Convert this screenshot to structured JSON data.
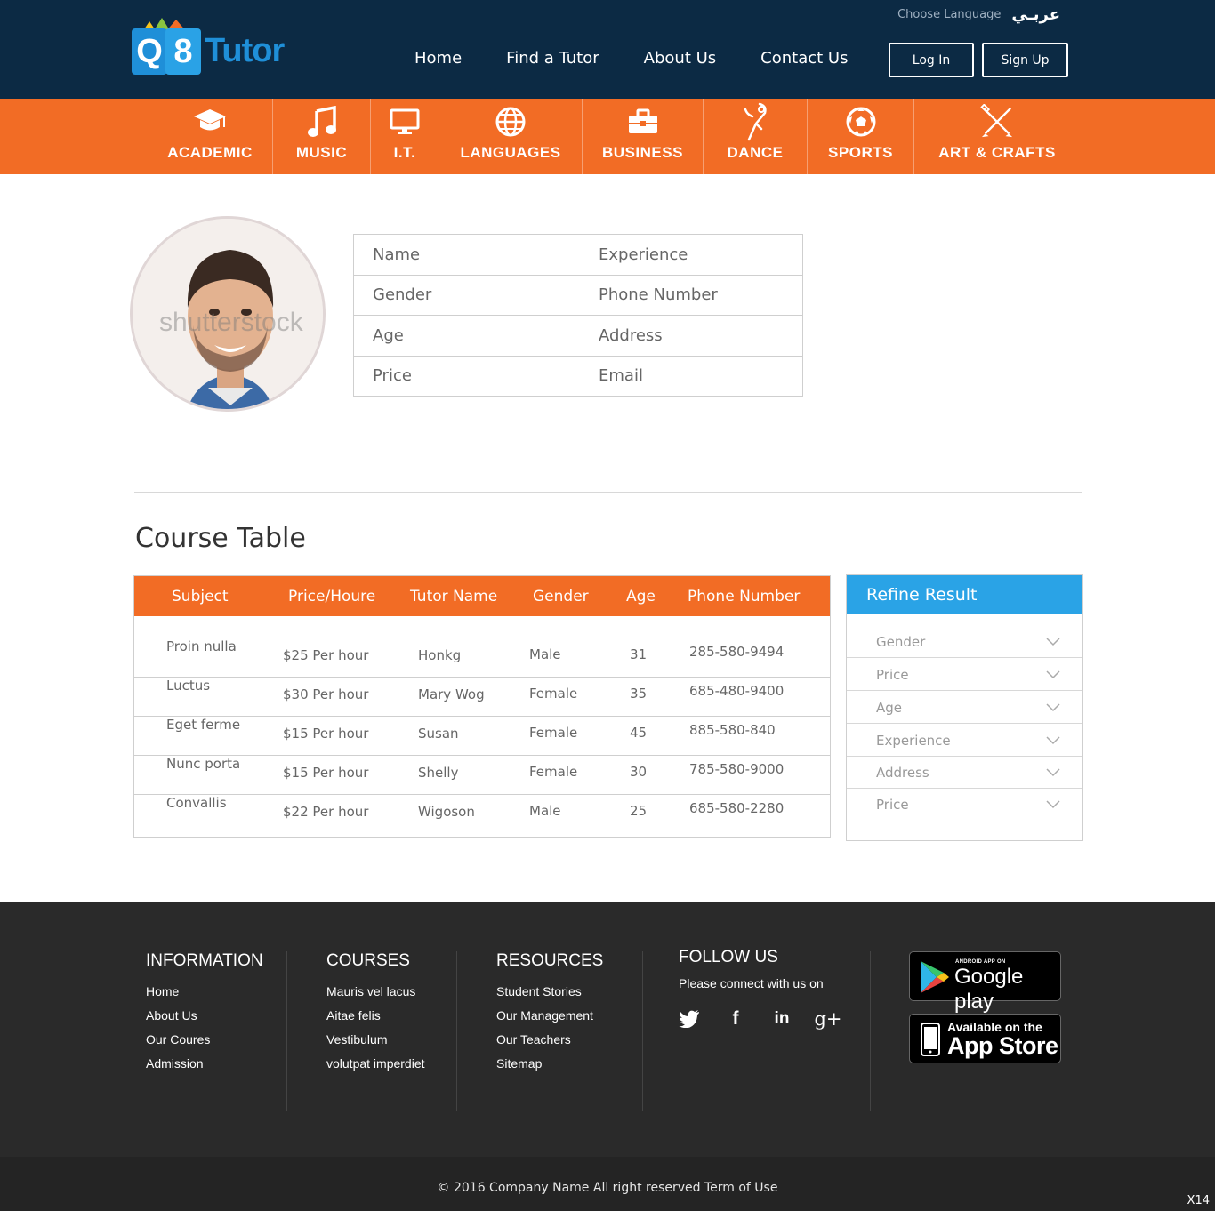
{
  "header": {
    "logo_text": "Tutor",
    "logo_q": "Q",
    "logo_8": "8",
    "choose_language": "Choose Language",
    "language_option": "عربـي",
    "nav": [
      "Home",
      "Find a Tutor",
      "About Us",
      "Contact Us"
    ],
    "login": "Log In",
    "signup": "Sign Up"
  },
  "categories": [
    {
      "label": "ACADEMIC",
      "icon": "graduation-cap-icon"
    },
    {
      "label": "MUSIC",
      "icon": "music-note-icon"
    },
    {
      "label": "I.T.",
      "icon": "monitor-icon"
    },
    {
      "label": "LANGUAGES",
      "icon": "globe-icon"
    },
    {
      "label": "BUSINESS",
      "icon": "briefcase-icon"
    },
    {
      "label": "DANCE",
      "icon": "dancer-icon"
    },
    {
      "label": "SPORTS",
      "icon": "soccer-ball-icon"
    },
    {
      "label": "ART & CRAFTS",
      "icon": "crossed-tools-icon"
    }
  ],
  "profile": {
    "watermark": "shutterstock",
    "fields": [
      [
        "Name",
        "Experience"
      ],
      [
        "Gender",
        "Phone Number"
      ],
      [
        "Age",
        "Address"
      ],
      [
        "Price",
        "Email"
      ]
    ]
  },
  "course_table": {
    "title": "Course Table",
    "headers": [
      "Subject",
      "Price/Houre",
      "Tutor Name",
      "Gender",
      "Age",
      "Phone Number"
    ],
    "rows": [
      [
        "Proin nulla",
        "$25 Per hour",
        "Honkg",
        "Male",
        "31",
        "285-580-9494"
      ],
      [
        "Luctus",
        "$30 Per hour",
        "Mary Wog",
        "Female",
        "35",
        "685-480-9400"
      ],
      [
        "Eget ferme",
        "$15 Per hour",
        "Susan",
        "Female",
        "45",
        "885-580-840"
      ],
      [
        "Nunc porta",
        "$15 Per hour",
        "Shelly",
        "Female",
        "30",
        "785-580-9000"
      ],
      [
        "Convallis",
        "$22 Per hour",
        "Wigoson",
        "Male",
        "25",
        "685-580-2280"
      ]
    ]
  },
  "refine": {
    "title": "Refine Result",
    "filters": [
      "Gender",
      "Price",
      "Age",
      "Experience",
      "Address",
      "Price"
    ]
  },
  "footer": {
    "information": {
      "title": "INFORMATION",
      "links": [
        "Home",
        "About Us",
        "Our Coures",
        "Admission"
      ]
    },
    "courses": {
      "title": "COURSES",
      "links": [
        "Mauris vel lacus",
        "Aitae felis",
        "Vestibulum",
        "volutpat imperdiet"
      ]
    },
    "resources": {
      "title": "RESOURCES",
      "links": [
        "Student Stories",
        "Our Management",
        "Our Teachers",
        "Sitemap"
      ]
    },
    "follow": {
      "title": "FOLLOW US",
      "text": "Please connect with us on",
      "icons": [
        "twitter-icon",
        "facebook-icon",
        "linkedin-icon",
        "google-plus-icon"
      ]
    },
    "google_play": {
      "small": "ANDROID APP ON",
      "big": "Google play"
    },
    "app_store": {
      "small": "Available on the",
      "big": "App Store"
    },
    "copyright": "© 2016 Company Name  All right reserved  Term of Use",
    "corner": "X14"
  },
  "colors": {
    "header_bg": "#0c2a44",
    "accent_orange": "#f26c25",
    "accent_blue": "#2aa3e6",
    "footer_bg": "#2a2a2a"
  }
}
